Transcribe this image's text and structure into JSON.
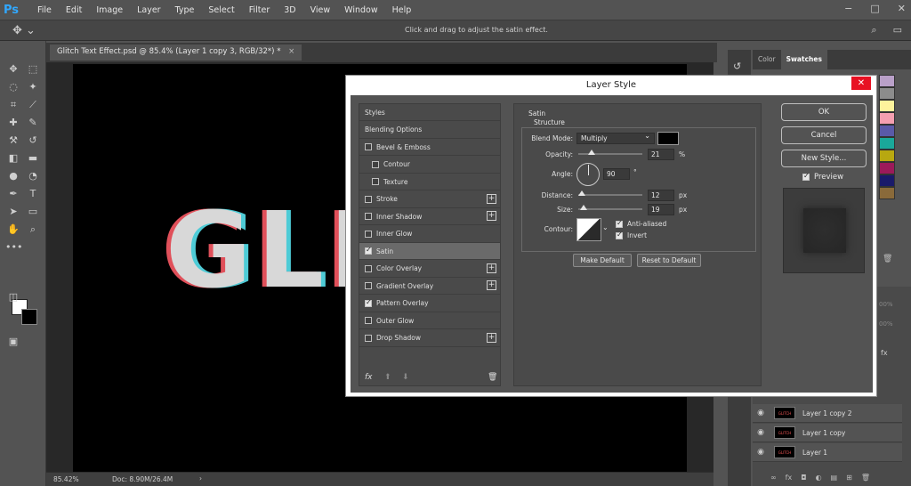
{
  "menubar": {
    "logo": "Ps",
    "items": [
      "File",
      "Edit",
      "Image",
      "Layer",
      "Type",
      "Select",
      "Filter",
      "3D",
      "View",
      "Window",
      "Help"
    ],
    "window_controls": [
      "−",
      "□",
      "✕"
    ]
  },
  "options_bar": {
    "hint": "Click and drag to adjust the satin effect."
  },
  "document": {
    "tab_title": "Glitch Text Effect.psd @ 85.4% (Layer 1 copy 3, RGB/32*) *",
    "tab_close": "×",
    "canvas_text": "GLI",
    "zoom": "85.42%",
    "doc_info": "Doc: 8.90M/26.4M"
  },
  "right_panel": {
    "tabs": [
      "Color",
      "Swatches"
    ],
    "swatch_colors": [
      "#b9a0c8",
      "#8c8c8c",
      "#fef39c",
      "#f59fb0",
      "#5a5aa8",
      "#1aa89a",
      "#b8a810",
      "#9c1a5a",
      "#1a1a6a",
      "#8a6a3a"
    ],
    "layers": [
      {
        "name": "Layer 1 copy 2",
        "thumb": "GLITCH"
      },
      {
        "name": "Layer 1 copy",
        "thumb": "GLITCH"
      },
      {
        "name": "Layer 1",
        "thumb": "GLITCH"
      }
    ],
    "partial_labels": [
      "00%",
      "00%"
    ]
  },
  "dialog": {
    "title": "Layer Style",
    "close": "✕",
    "styles": [
      {
        "label": "Styles",
        "checkbox": false,
        "checked": false,
        "plus": false,
        "indent": false
      },
      {
        "label": "Blending Options",
        "checkbox": false,
        "checked": false,
        "plus": false,
        "indent": false
      },
      {
        "label": "Bevel & Emboss",
        "checkbox": true,
        "checked": false,
        "plus": false,
        "indent": false
      },
      {
        "label": "Contour",
        "checkbox": true,
        "checked": false,
        "plus": false,
        "indent": true
      },
      {
        "label": "Texture",
        "checkbox": true,
        "checked": false,
        "plus": false,
        "indent": true
      },
      {
        "label": "Stroke",
        "checkbox": true,
        "checked": false,
        "plus": true,
        "indent": false
      },
      {
        "label": "Inner Shadow",
        "checkbox": true,
        "checked": false,
        "plus": true,
        "indent": false
      },
      {
        "label": "Inner Glow",
        "checkbox": true,
        "checked": false,
        "plus": false,
        "indent": false
      },
      {
        "label": "Satin",
        "checkbox": true,
        "checked": true,
        "plus": false,
        "indent": false,
        "active": true
      },
      {
        "label": "Color Overlay",
        "checkbox": true,
        "checked": false,
        "plus": true,
        "indent": false
      },
      {
        "label": "Gradient Overlay",
        "checkbox": true,
        "checked": false,
        "plus": true,
        "indent": false
      },
      {
        "label": "Pattern Overlay",
        "checkbox": true,
        "checked": true,
        "plus": false,
        "indent": false
      },
      {
        "label": "Outer Glow",
        "checkbox": true,
        "checked": false,
        "plus": false,
        "indent": false
      },
      {
        "label": "Drop Shadow",
        "checkbox": true,
        "checked": false,
        "plus": true,
        "indent": false
      }
    ],
    "satin": {
      "section_title": "Satin",
      "group_title": "Structure",
      "blend_mode_label": "Blend Mode:",
      "blend_mode_value": "Multiply",
      "blend_color": "#000000",
      "opacity_label": "Opacity:",
      "opacity_value": "21",
      "opacity_unit": "%",
      "opacity_level": 0.21,
      "angle_label": "Angle:",
      "angle_value": "90",
      "angle_unit": "°",
      "distance_label": "Distance:",
      "distance_value": "12",
      "distance_unit": "px",
      "distance_level": 0.05,
      "size_label": "Size:",
      "size_value": "19",
      "size_unit": "px",
      "size_level": 0.08,
      "contour_label": "Contour:",
      "anti_aliased_label": "Anti-aliased",
      "anti_aliased_checked": true,
      "invert_label": "Invert",
      "invert_checked": true,
      "make_default": "Make Default",
      "reset_default": "Reset to Default"
    },
    "buttons": {
      "ok": "OK",
      "cancel": "Cancel",
      "new_style": "New Style...",
      "preview_label": "Preview",
      "preview_checked": true
    }
  }
}
